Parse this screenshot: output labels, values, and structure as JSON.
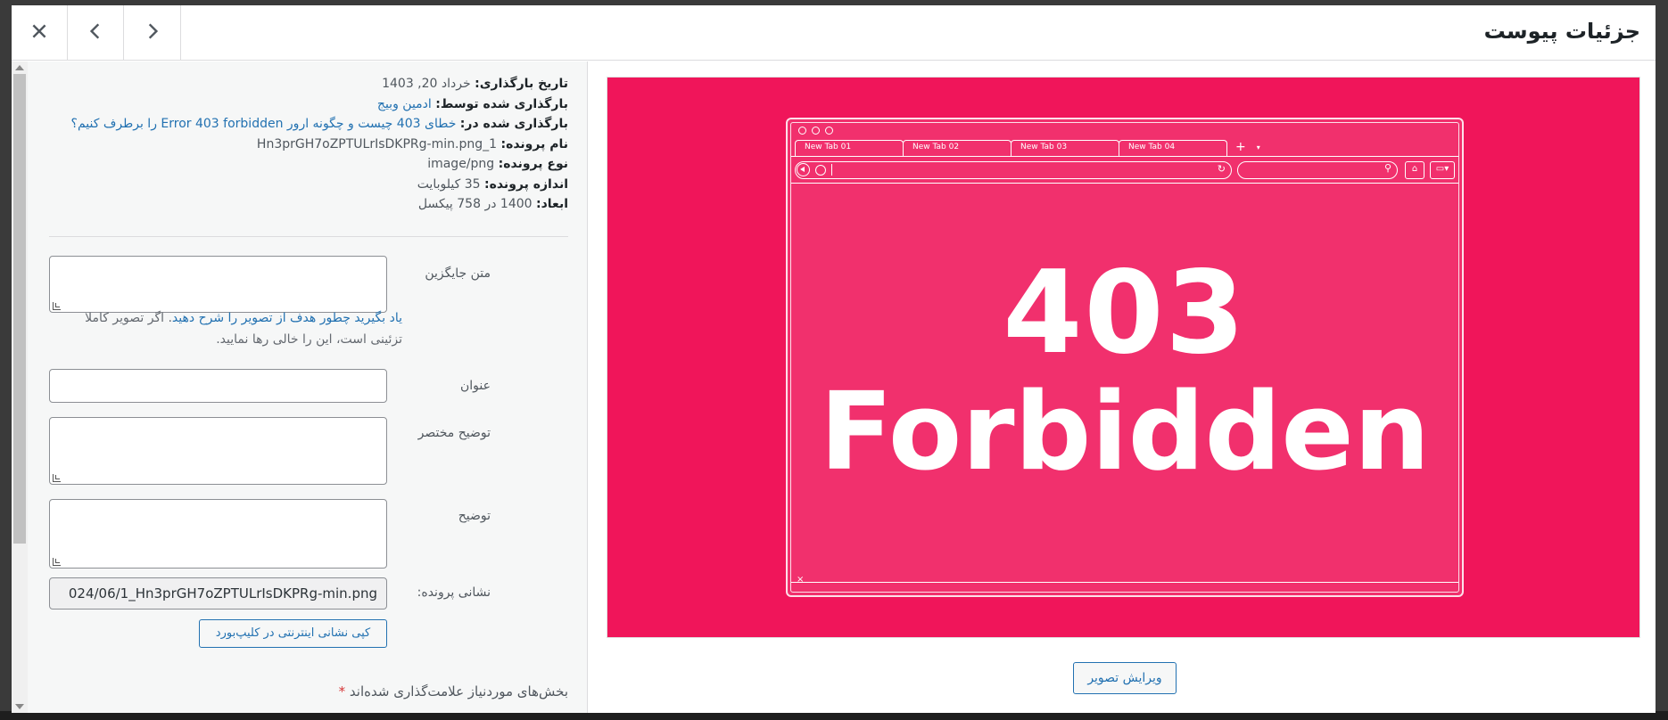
{
  "header": {
    "title": "جزئیات پیوست",
    "close_icon": "close-icon",
    "prev_icon": "chevron-left-icon",
    "next_icon": "chevron-right-icon"
  },
  "details": {
    "uploaded_on_label": "تاریخ بارگذاری:",
    "uploaded_on_value": "خرداد 20, 1403",
    "uploaded_by_label": "بارگذاری شده توسط:",
    "uploaded_by_value": "ادمین وبیج",
    "uploaded_to_label": "بارگذاری شده در:",
    "uploaded_to_value": "خطای 403 چیست و چگونه ارور Error 403 forbidden را برطرف کنیم؟",
    "file_name_label": "نام پرونده:",
    "file_name_value": "Hn3prGH7oZPTULrIsDKPRg-min.png_1",
    "file_type_label": "نوع پرونده:",
    "file_type_value": "image/png",
    "file_size_label": "اندازه پرونده:",
    "file_size_value": "35 کیلوبایت",
    "dimensions_label": "ابعاد:",
    "dimensions_value": "1400 در 758 پیکسل"
  },
  "fields": {
    "alt_text_label": "متن جایگزین",
    "alt_text_value": "",
    "alt_help_link": "یاد بگیرید چطور هدف از تصویر را شرح دهید",
    "alt_help_rest": ". اگر تصویر کاملا تزئینی است، این را خالی رها نمایید.",
    "title_label": "عنوان",
    "title_value": "",
    "caption_label": "توضیح مختصر",
    "caption_value": "",
    "description_label": "توضیح",
    "description_value": "",
    "file_url_label": "نشانی پرونده:",
    "file_url_value": "024/06/1_Hn3prGH7oZPTULrIsDKPRg-min.png",
    "copy_button": "کپی نشانی اینترنتی در کلیپ‌بورد",
    "required_note": "بخش‌های موردنیاز علامت‌گذاری شده‌اند",
    "required_star": "*"
  },
  "preview": {
    "tabs": [
      "New Tab 01",
      "New Tab 02",
      "New Tab 03",
      "New Tab 04"
    ],
    "tab_plus": "+",
    "tab_caret": "▾",
    "line1": "403",
    "line2": "Forbidden",
    "close_glyph": "×",
    "bg_color": "#f0155a",
    "edit_button": "ویرایش تصویر"
  }
}
